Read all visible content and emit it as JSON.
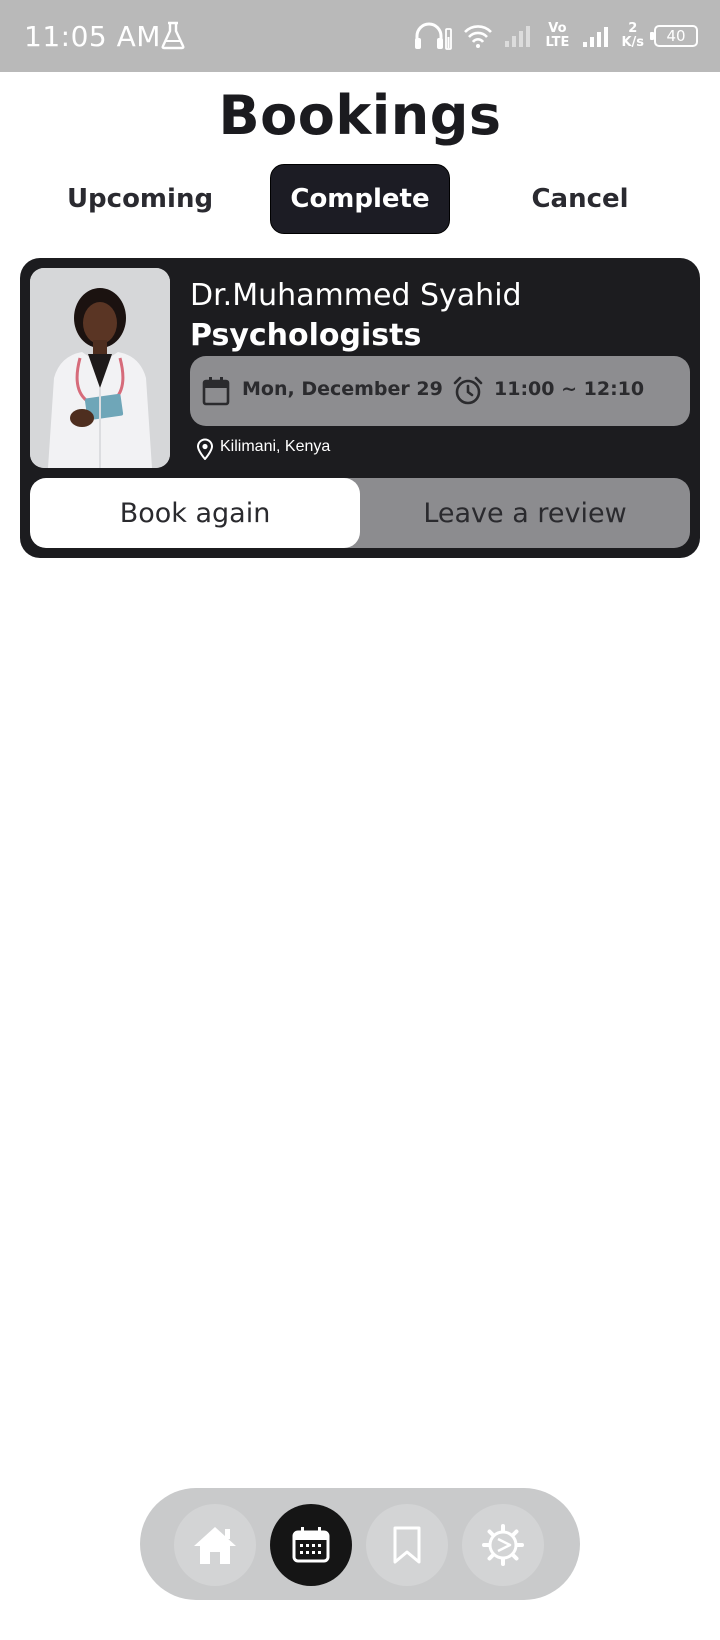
{
  "status_bar": {
    "time": "11:05 AM",
    "network": "Vo LTE",
    "speed_value": "2",
    "speed_unit": "K/s",
    "battery": "40",
    "icons": [
      "flask-icon",
      "headphones-icon",
      "wifi-icon",
      "signal-icon",
      "battery-icon"
    ]
  },
  "page": {
    "title": "Bookings"
  },
  "tabs": [
    {
      "label": "Upcoming",
      "active": false
    },
    {
      "label": "Complete",
      "active": true
    },
    {
      "label": "Cancel",
      "active": false
    }
  ],
  "booking": {
    "doctor_name": "Dr.Muhammed Syahid",
    "specialty": "Psychologists",
    "date": "Mon, December 29",
    "time": "11:00 ~ 12:10",
    "location": "Kilimani, Kenya",
    "primary_action": "Book again",
    "secondary_action": "Leave a review",
    "photo_icon": "doctor-portrait"
  },
  "bottom_nav": {
    "items": [
      {
        "icon": "home-icon",
        "active": false
      },
      {
        "icon": "calendar-icon",
        "active": true
      },
      {
        "icon": "bookmark-icon",
        "active": false
      },
      {
        "icon": "settings-icon",
        "active": false
      }
    ]
  },
  "colors": {
    "status_bar": "#b9b9b9",
    "card_bg": "#1c1c1f",
    "active_tab": "#1c1c24",
    "datetime_bg": "#8d8d90",
    "nav_bg": "#c9cacb"
  }
}
